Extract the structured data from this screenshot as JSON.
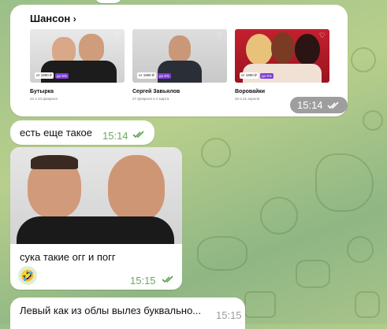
{
  "colors": {
    "accent": "#5fa052",
    "bubble": "#ffffff",
    "badge": "#7d3fd6"
  },
  "shared_card": {
    "section_title": "Шансон",
    "chevron_icon": "chevron-right-icon",
    "time": "15:14",
    "items": [
      {
        "name": "Бутырка",
        "dates": "22 и 23 февраля",
        "price": "от 1900 ₽",
        "badge": "до 6%"
      },
      {
        "name": "Сергей Завьялов",
        "dates": "27 февраля и 2 марта",
        "price": "от 1900 ₽",
        "badge": "до 6%"
      },
      {
        "name": "Воровайки",
        "dates": "20 и 21 апреля",
        "price": "от 1900 ₽",
        "badge": "до 6%"
      }
    ]
  },
  "messages": [
    {
      "text": "есть еще такое",
      "time": "15:14"
    },
    {
      "text": "сука такие огг и погг",
      "time": "15:15",
      "reaction": "🤣"
    },
    {
      "text": "Левый как из облы вылез буквально...",
      "time": "15:15"
    }
  ]
}
